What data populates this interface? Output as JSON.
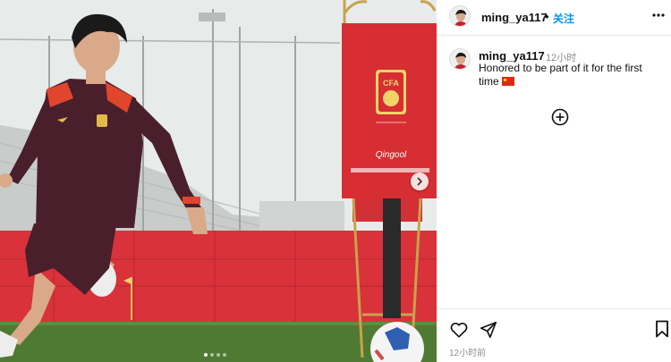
{
  "post": {
    "username": "ming_ya117",
    "follow_label": "关注",
    "separator": "•",
    "caption_user": "ming_ya117",
    "caption_time": "12小时",
    "caption_text": "Honored to be part of it for the first time",
    "caption_emoji": "china-flag-emoji",
    "post_time": "12小时前"
  },
  "photo": {
    "badge_text": "CFA",
    "sponsor_text": "Qingool",
    "carousel_dots": 4,
    "active_dot": 0
  },
  "icons": {
    "more": "more-options-icon",
    "add_comment": "add-circle-icon",
    "like": "heart-icon",
    "share": "send-icon",
    "save": "bookmark-icon",
    "next": "chevron-right-icon"
  },
  "colors": {
    "follow_blue": "#0095f6",
    "banner_red": "#d9323a",
    "jersey_maroon": "#4a1f2c",
    "grass_green": "#4f7a33"
  }
}
